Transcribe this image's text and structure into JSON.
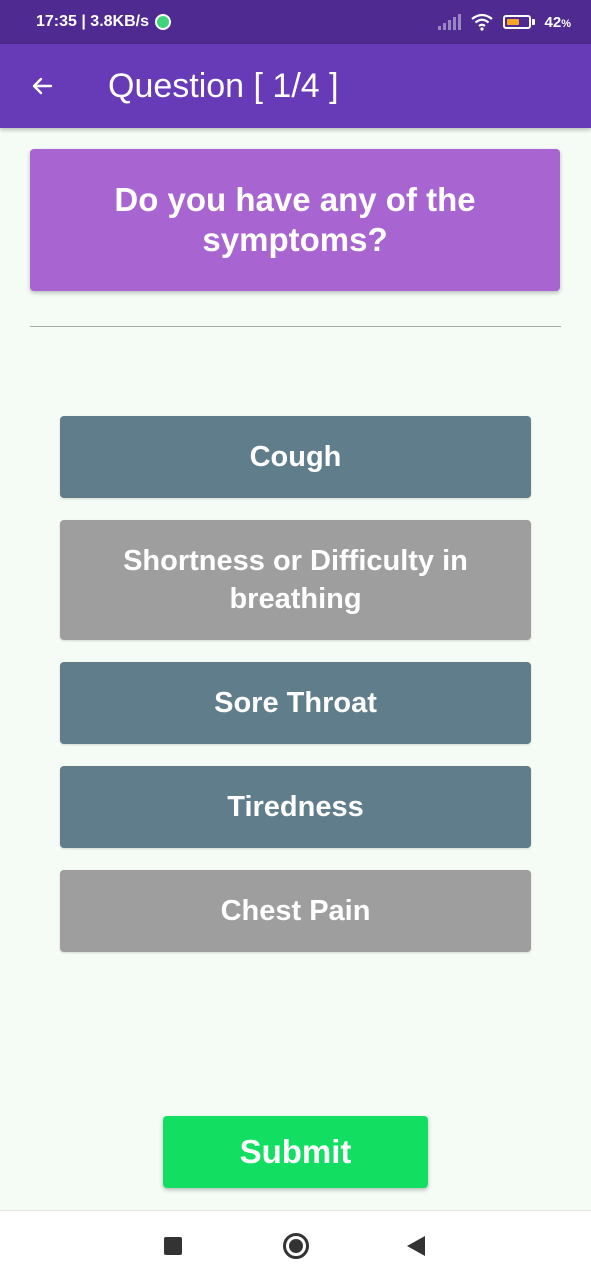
{
  "status_bar": {
    "time_speed": "17:35 | 3.8KB/s",
    "battery_percent": "42",
    "battery_pct_sign": "%",
    "icons": [
      "whatsapp-icon",
      "signal-icon",
      "wifi-icon",
      "battery-icon"
    ]
  },
  "app_bar": {
    "title": "Question [ 1/4 ]",
    "back_icon": "arrow-left-icon",
    "color": "#673ab7"
  },
  "question": {
    "text": "Do you have any of the symptoms?",
    "card_color": "#a864d1"
  },
  "options": [
    {
      "label": "Cough",
      "style": "dark"
    },
    {
      "label": "Shortness or Difficulty in breathing",
      "style": "grey"
    },
    {
      "label": "Sore Throat",
      "style": "dark"
    },
    {
      "label": "Tiredness",
      "style": "dark"
    },
    {
      "label": "Chest Pain",
      "style": "grey"
    }
  ],
  "option_colors": {
    "dark": "#607d8b",
    "grey": "#9e9e9e"
  },
  "submit": {
    "label": "Submit",
    "color": "#12df62"
  },
  "nav_bar": {
    "icons": [
      "recents-icon",
      "home-icon",
      "back-icon"
    ]
  }
}
